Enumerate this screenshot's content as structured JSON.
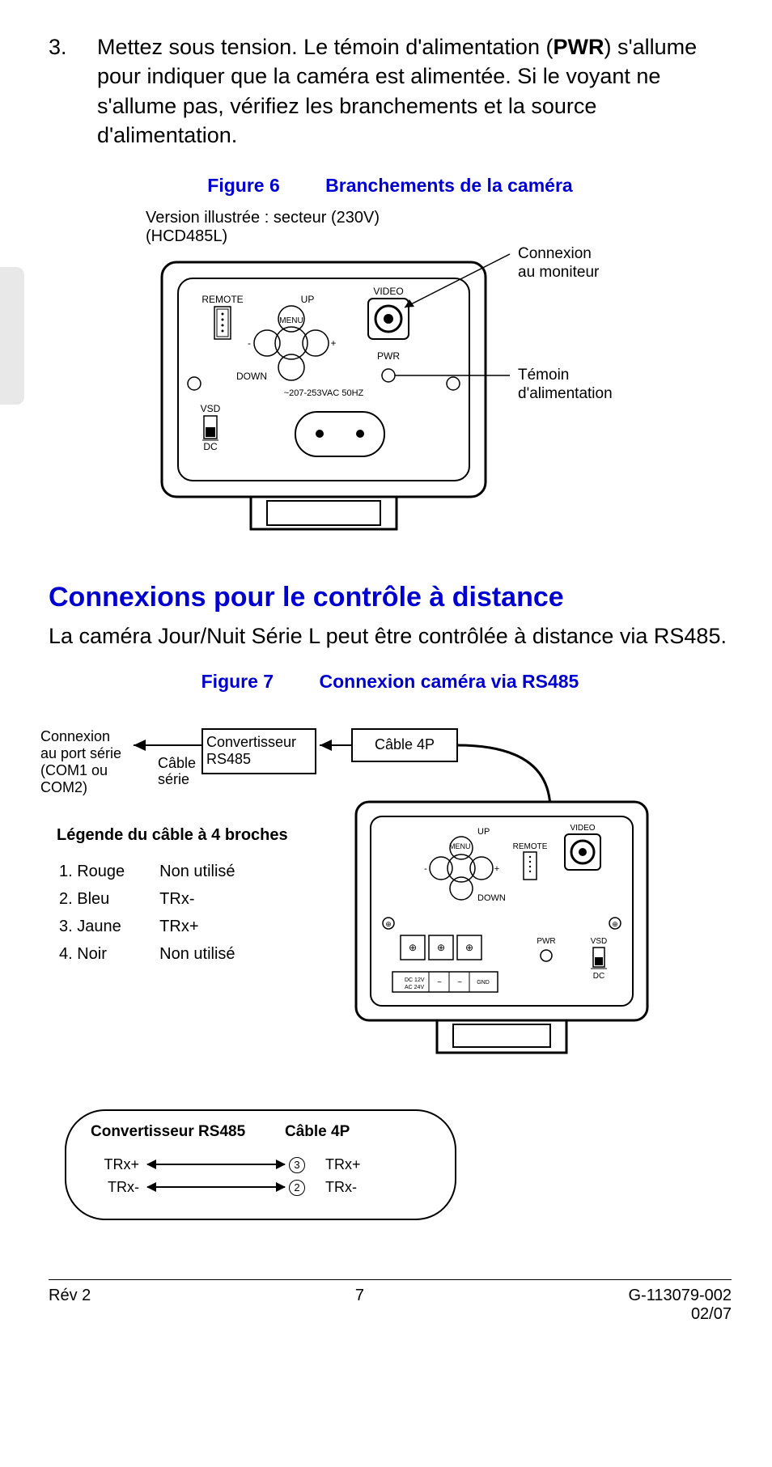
{
  "step": {
    "number": "3.",
    "text_before_bold": "Mettez sous tension. Le témoin d'alimentation (",
    "bold": "PWR",
    "text_after_bold": ") s'allume pour indiquer que la caméra est alimentée. Si le voyant ne s'allume pas, vérifiez les branchements et la source d'alimentation."
  },
  "figure6": {
    "label": "Figure 6",
    "title": "Branchements de la caméra",
    "note_line1": "Version illustrée : secteur (230V)",
    "note_line2": "(HCD485L)",
    "labels": {
      "remote": "REMOTE",
      "up": "UP",
      "menu": "MENU",
      "down": "DOWN",
      "video": "VIDEO",
      "pwr": "PWR",
      "voltage": "~207-253VAC 50HZ",
      "vsd": "VSD",
      "dc": "DC",
      "minus": "-",
      "plus": "+"
    },
    "callouts": {
      "monitor_l1": "Connexion",
      "monitor_l2": "au moniteur",
      "power_l1": "Témoin",
      "power_l2": "d'alimentation"
    }
  },
  "section": {
    "heading": "Connexions pour le contrôle à distance",
    "body": "La caméra Jour/Nuit Série L peut être contrôlée à distance via RS485."
  },
  "figure7": {
    "label": "Figure 7",
    "title": "Connexion caméra via RS485",
    "flow": {
      "serial_port_l1": "Connexion",
      "serial_port_l2": "au port série",
      "serial_port_l3": "(COM1 ou",
      "serial_port_l4": "COM2)",
      "serial_cable_l1": "Câble",
      "serial_cable_l2": "série",
      "converter_l1": "Convertisseur",
      "converter_l2": "RS485",
      "cable4p": "Câble 4P"
    },
    "camera_labels": {
      "up": "UP",
      "menu": "MENU",
      "down": "DOWN",
      "remote": "REMOTE",
      "video": "VIDEO",
      "pwr": "PWR",
      "vsd": "VSD",
      "dc": "DC",
      "dc12v": "DC 12V",
      "ac24v": "AC 24V",
      "gnd": "GND",
      "tilde": "~",
      "minus": "-",
      "plus": "+"
    },
    "legend": {
      "title": "Légende du câble à 4 broches",
      "rows": [
        {
          "n": "1. Rouge",
          "v": "Non utilisé"
        },
        {
          "n": "2. Bleu",
          "v": "TRx-"
        },
        {
          "n": "3. Jaune",
          "v": "TRx+"
        },
        {
          "n": "4. Noir",
          "v": "Non utilisé"
        }
      ]
    },
    "wiring": {
      "head_left": "Convertisseur RS485",
      "head_right": "Câble 4P",
      "rows": [
        {
          "left": "TRx+",
          "pin": "3",
          "right": "TRx+"
        },
        {
          "left": "TRx-",
          "pin": "2",
          "right": "TRx-"
        }
      ]
    }
  },
  "footer": {
    "rev": "Rév  2",
    "page": "7",
    "docnum": "G-113079-002",
    "date": "02/07"
  }
}
